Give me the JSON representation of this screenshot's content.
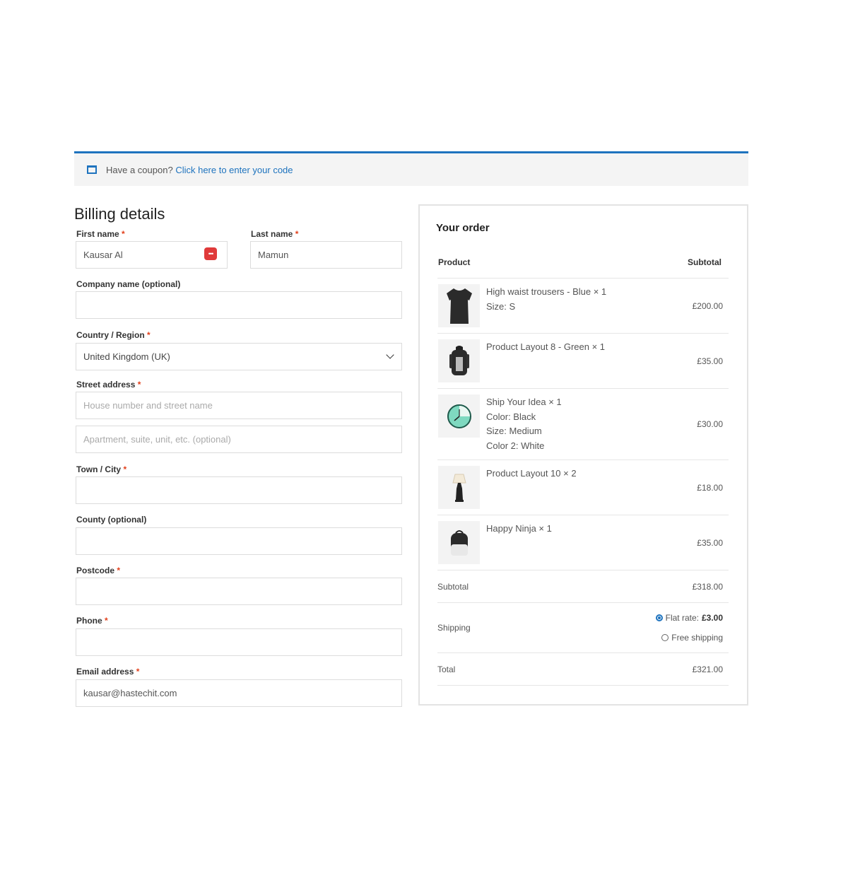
{
  "coupon": {
    "text": "Have a coupon?",
    "link": "Click here to enter your code"
  },
  "billing": {
    "title": "Billing details",
    "first_name": {
      "label": "First name",
      "value": "Kausar Al"
    },
    "last_name": {
      "label": "Last name",
      "value": "Mamun"
    },
    "company": {
      "label": "Company name (optional)",
      "value": ""
    },
    "country": {
      "label": "Country / Region",
      "value": "United Kingdom (UK)"
    },
    "street": {
      "label": "Street address",
      "placeholder1": "House number and street name",
      "placeholder2": "Apartment, suite, unit, etc. (optional)"
    },
    "town": {
      "label": "Town / City",
      "value": ""
    },
    "county": {
      "label": "County (optional)",
      "value": ""
    },
    "postcode": {
      "label": "Postcode",
      "value": ""
    },
    "phone": {
      "label": "Phone",
      "value": ""
    },
    "email": {
      "label": "Email address",
      "value": "kausar@hastechit.com"
    },
    "required_mark": "*"
  },
  "order": {
    "title": "Your order",
    "col_product": "Product",
    "col_subtotal": "Subtotal",
    "items": [
      {
        "lines": [
          "High waist trousers - Blue × 1",
          "Size: S"
        ],
        "price": "£200.00",
        "icon": "tshirt-icon"
      },
      {
        "lines": [
          "Product Layout 8 - Green × 1"
        ],
        "price": "£35.00",
        "icon": "backpack-icon"
      },
      {
        "lines": [
          "Ship Your Idea × 1",
          "Color: Black",
          "Size: Medium",
          "Color 2: White"
        ],
        "price": "£30.00",
        "icon": "clock-icon"
      },
      {
        "lines": [
          "Product Layout 10 × 2"
        ],
        "price": "£18.00",
        "icon": "lamp-icon"
      },
      {
        "lines": [
          "Happy Ninja × 1"
        ],
        "price": "£35.00",
        "icon": "bag-icon"
      }
    ],
    "subtotal_label": "Subtotal",
    "subtotal_value": "£318.00",
    "shipping_label": "Shipping",
    "shipping_options": [
      {
        "label": "Flat rate:",
        "amount": "£3.00",
        "selected": true
      },
      {
        "label": "Free shipping",
        "amount": "",
        "selected": false
      }
    ],
    "total_label": "Total",
    "total_value": "£321.00"
  },
  "colors": {
    "accent": "#1e73be",
    "required": "#e2401c",
    "password_icon": "#e03a3a"
  }
}
